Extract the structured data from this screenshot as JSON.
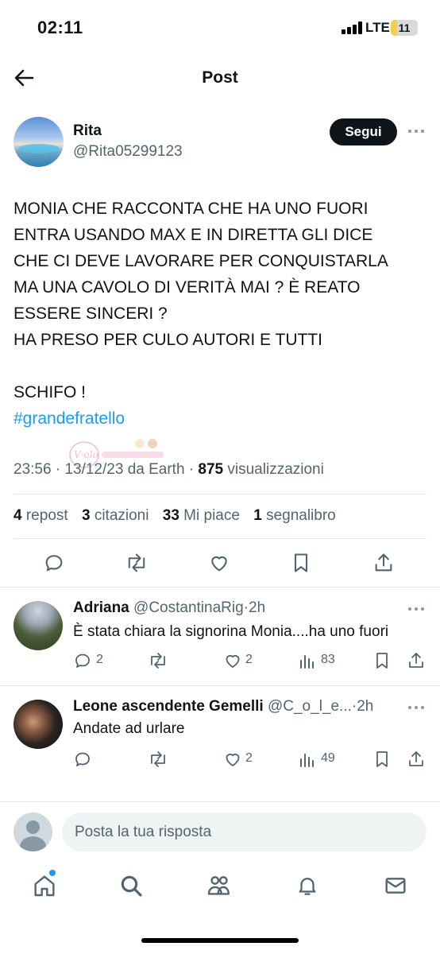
{
  "status_bar": {
    "time": "02:11",
    "network": "LTE",
    "battery": "11",
    "battery_level_percent": 11
  },
  "header": {
    "title": "Post"
  },
  "post": {
    "author_name": "Rita",
    "author_handle": "@Rita05299123",
    "follow_label": "Segui",
    "text": "MONIA CHE RACCONTA CHE HA UNO FUORI\nENTRA USANDO MAX E IN DIRETTA GLI DICE\nCHE CI DEVE LAVORARE PER CONQUISTARLA\nMA UNA CAVOLO DI VERITÀ MAI ? È REATO\nESSERE SINCERI ?\nHA PRESO PER CULO AUTORI E TUTTI\n\nSCHIFO !",
    "hashtag": "#grandefratello",
    "time": "23:56",
    "date": "13/12/23",
    "source": "da Earth",
    "views_count": "875",
    "views_label": "visualizzazioni",
    "stats": {
      "reposts_count": "4",
      "reposts_label": "repost",
      "quotes_count": "3",
      "quotes_label": "citazioni",
      "likes_count": "33",
      "likes_label": "Mi piace",
      "bookmarks_count": "1",
      "bookmarks_label": "segnalibro"
    }
  },
  "replies": [
    {
      "name": "Adriana",
      "handle": "@CostantinaRig",
      "age": "2h",
      "text": "È stata chiara la signorina Monia....ha uno fuori",
      "replies_count": "2",
      "likes_count": "2",
      "views_count": "83"
    },
    {
      "name": "Leone ascendente Gemelli",
      "handle": "@C_o_l_e...",
      "age": "2h",
      "text": "Andate ad urlare",
      "likes_count": "2",
      "views_count": "49"
    }
  ],
  "composer": {
    "placeholder": "Posta la tua risposta"
  },
  "colors": {
    "accent": "#1d9bf0",
    "text": "#0f1419",
    "secondary": "#536471",
    "divider": "#e6e9eb",
    "input_bg": "#eff3f4"
  },
  "icons": [
    "back-arrow-icon",
    "more-icon",
    "reply-icon",
    "repost-icon",
    "like-icon",
    "bookmark-icon",
    "share-icon",
    "views-icon",
    "home-icon",
    "search-icon",
    "communities-icon",
    "notifications-icon",
    "messages-icon"
  ]
}
